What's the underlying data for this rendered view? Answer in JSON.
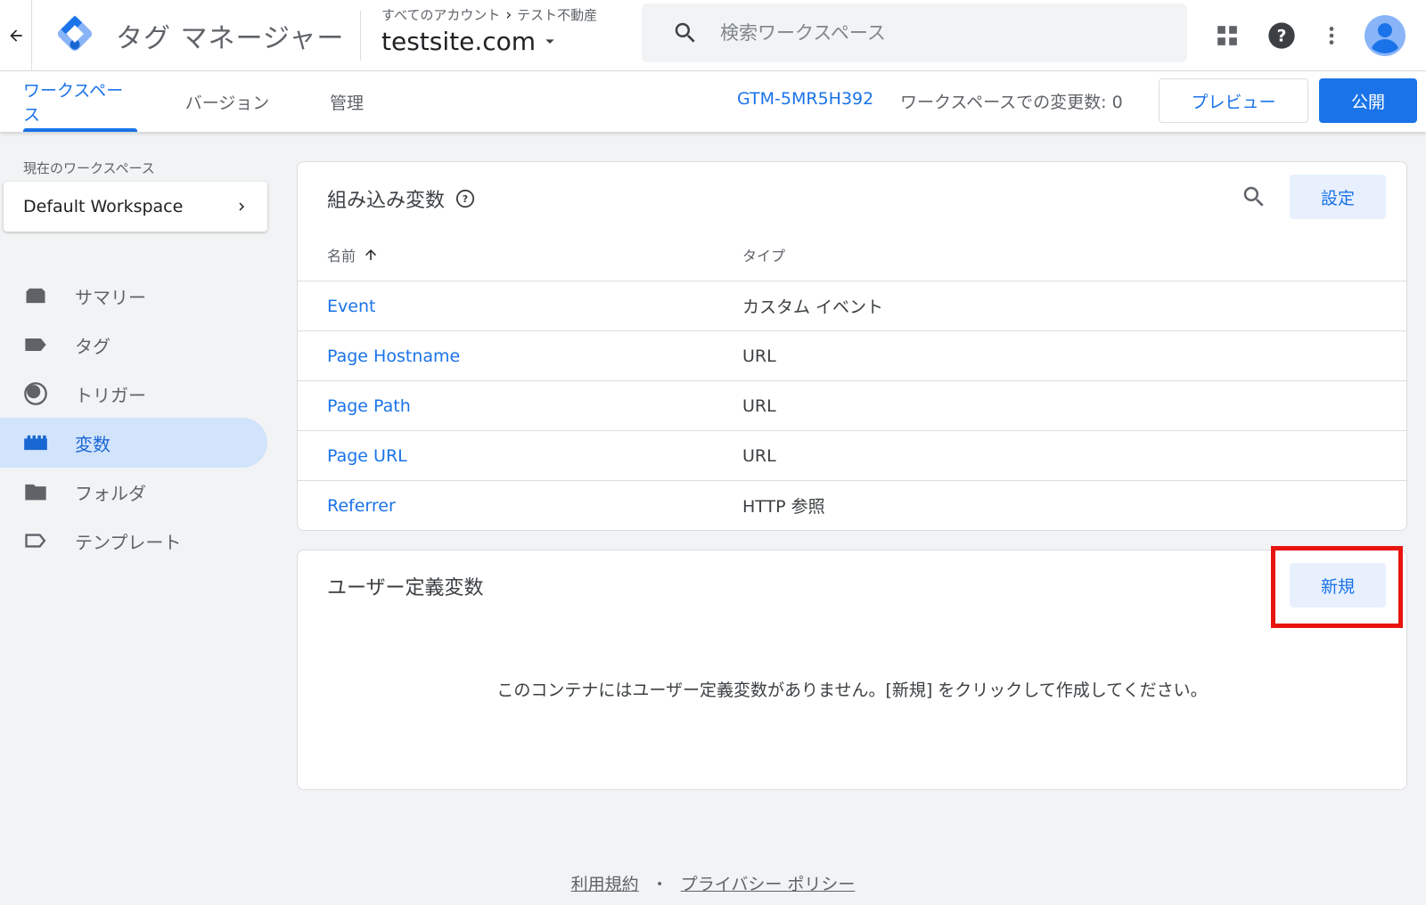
{
  "header": {
    "product_name": "タグ マネージャー",
    "breadcrumb_account": "すべてのアカウント",
    "breadcrumb_separator": "›",
    "breadcrumb_property": "テスト不動産",
    "container_name": "testsite.com",
    "search_placeholder": "検索ワークスペース"
  },
  "tabs": [
    {
      "label": "ワークスペース",
      "active": true
    },
    {
      "label": "バージョン",
      "active": false
    },
    {
      "label": "管理",
      "active": false
    }
  ],
  "toolbar": {
    "container_id": "GTM-5MR5H392",
    "changes_label": "ワークスペースでの変更数: 0",
    "preview_label": "プレビュー",
    "publish_label": "公開"
  },
  "sidebar": {
    "workspace_label": "現在のワークスペース",
    "workspace_name": "Default Workspace",
    "items": [
      {
        "label": "サマリー",
        "icon": "summary-icon"
      },
      {
        "label": "タグ",
        "icon": "tag-icon"
      },
      {
        "label": "トリガー",
        "icon": "trigger-icon"
      },
      {
        "label": "変数",
        "icon": "variables-icon",
        "active": true
      },
      {
        "label": "フォルダ",
        "icon": "folder-icon"
      },
      {
        "label": "テンプレート",
        "icon": "template-icon"
      }
    ]
  },
  "builtin": {
    "title": "組み込み変数",
    "settings_label": "設定",
    "col_name": "名前",
    "col_type": "タイプ",
    "rows": [
      {
        "name": "Event",
        "type": "カスタム イベント"
      },
      {
        "name": "Page Hostname",
        "type": "URL"
      },
      {
        "name": "Page Path",
        "type": "URL"
      },
      {
        "name": "Page URL",
        "type": "URL"
      },
      {
        "name": "Referrer",
        "type": "HTTP 参照"
      }
    ]
  },
  "user_defined": {
    "title": "ユーザー定義変数",
    "new_label": "新規",
    "empty_message": "このコンテナにはユーザー定義変数がありません。[新規] をクリックして作成してください。"
  },
  "footer": {
    "terms": "利用規約",
    "separator": "・",
    "privacy": "プライバシー ポリシー"
  },
  "colors": {
    "accent": "#1a73e8",
    "highlight": "#e8150f",
    "active_nav_bg": "#d2e3fc"
  }
}
